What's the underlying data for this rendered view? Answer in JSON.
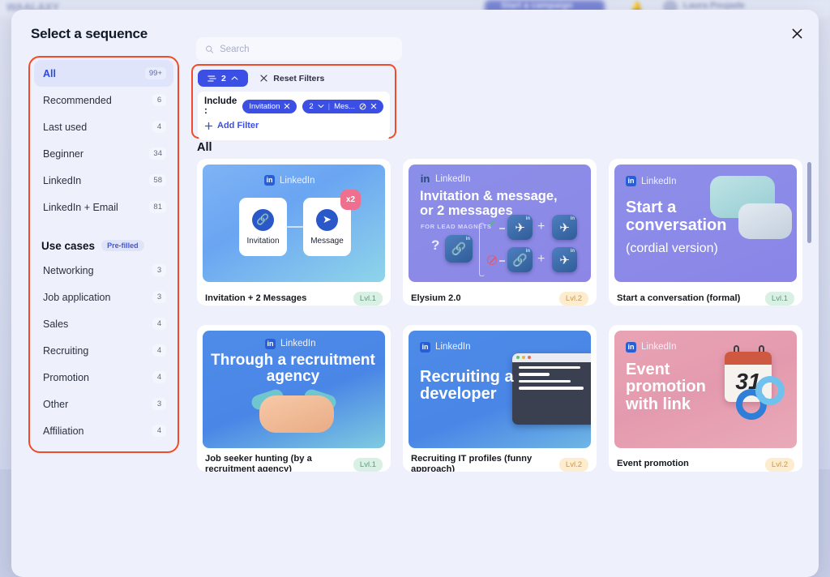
{
  "backdrop": {
    "app_name": "WAALAXY",
    "cta_label": "Start a campaign",
    "user_name": "Laura Poujade",
    "bell_icon": "bell-icon"
  },
  "modal": {
    "title": "Select a sequence",
    "close_icon": "close-icon"
  },
  "search": {
    "placeholder": "Search",
    "value": "",
    "icon": "search-icon"
  },
  "filters": {
    "toggle_icon": "filter-sliders-icon",
    "toggle_count": "2",
    "toggle_chevron": "chevron-up-icon",
    "reset_label": "Reset Filters",
    "reset_icon": "close-x-icon",
    "include_label": "Include :",
    "chips": [
      {
        "label": "Invitation",
        "remove_icon": "close-x-icon",
        "has_count": false
      },
      {
        "label": "Mes...",
        "count": "2",
        "chevron": "chevron-down-icon",
        "block_icon": "no-entry-icon",
        "remove_icon": "close-x-icon",
        "has_count": true
      }
    ],
    "add_filter_label": "Add Filter",
    "add_filter_icon": "plus-icon"
  },
  "sidebar": {
    "items": [
      {
        "label": "All",
        "count": "99+",
        "active": true
      },
      {
        "label": "Recommended",
        "count": "6",
        "active": false
      },
      {
        "label": "Last used",
        "count": "4",
        "active": false
      },
      {
        "label": "Beginner",
        "count": "34",
        "active": false
      },
      {
        "label": "LinkedIn",
        "count": "58",
        "active": false
      },
      {
        "label": "LinkedIn + Email",
        "count": "81",
        "active": false
      }
    ],
    "section": {
      "title": "Use cases",
      "pill": "Pre-filled"
    },
    "use_cases": [
      {
        "label": "Networking",
        "count": "3"
      },
      {
        "label": "Job application",
        "count": "3"
      },
      {
        "label": "Sales",
        "count": "4"
      },
      {
        "label": "Recruiting",
        "count": "4"
      },
      {
        "label": "Promotion",
        "count": "4"
      },
      {
        "label": "Other",
        "count": "3"
      },
      {
        "label": "Affiliation",
        "count": "4"
      }
    ]
  },
  "results": {
    "heading": "All",
    "cards": [
      {
        "name": "Invitation + 2 Messages",
        "level": "Lvl.1",
        "level_class": "l1",
        "brand": "LinkedIn",
        "art_title": "",
        "nodes": [
          {
            "label": "Invitation",
            "icon": "link-icon"
          },
          {
            "label": "Message",
            "icon": "send-icon"
          }
        ],
        "badge": "x2"
      },
      {
        "name": "Elysium 2.0",
        "level": "Lvl.2",
        "level_class": "l2",
        "brand": "LinkedIn",
        "art_title": "Invitation & message, or 2 messages",
        "art_subtitle": "FOR LEAD MAGNETS",
        "question": "?"
      },
      {
        "name": "Start a conversation (formal)",
        "level": "Lvl.1",
        "level_class": "l1",
        "brand": "LinkedIn",
        "art_title": "Start a conversation",
        "art_subtitle": "(cordial version)"
      },
      {
        "name": "Job seeker hunting (by a recruitment agency)",
        "level": "Lvl.1",
        "level_class": "l1",
        "brand": "LinkedIn",
        "art_title": "Through a recruitment agency"
      },
      {
        "name": "Recruiting IT profiles (funny approach)",
        "level": "Lvl.2",
        "level_class": "l2",
        "brand": "LinkedIn",
        "art_title": "Recruiting a developer"
      },
      {
        "name": "Event promotion",
        "level": "Lvl.2",
        "level_class": "l2",
        "brand": "LinkedIn",
        "art_title": "Event promotion with link",
        "calendar_day": "31"
      }
    ]
  },
  "colors": {
    "accent": "#3b4fe4",
    "highlight": "#f04b2a",
    "modal_bg": "#eef1fb",
    "level1_badge": "#d9f0e4",
    "level2_badge": "#fdeccd"
  }
}
